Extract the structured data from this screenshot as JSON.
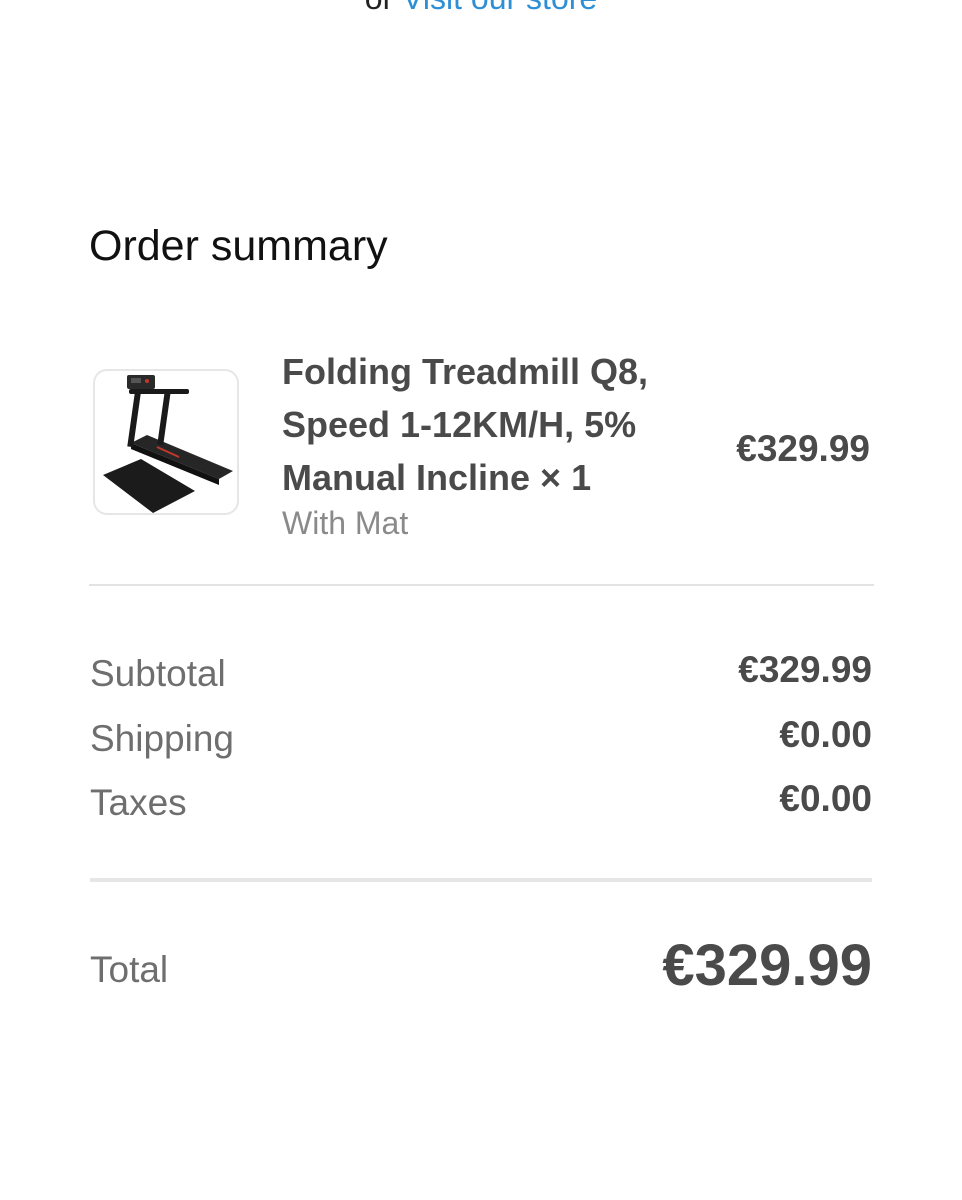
{
  "header": {
    "prefix": "or",
    "store_link": "Visit our store"
  },
  "order_summary": {
    "title": "Order summary",
    "item": {
      "image_icon": "treadmill-product-image",
      "name": "Folding Treadmill Q8, Speed 1-12KM/H, 5% Manual Incline × 1",
      "variant": "With Mat",
      "price": "€329.99"
    },
    "subtotal": {
      "label": "Subtotal",
      "value": "€329.99"
    },
    "shipping": {
      "label": "Shipping",
      "value": "€0.00"
    },
    "taxes": {
      "label": "Taxes",
      "value": "€0.00"
    },
    "total": {
      "label": "Total",
      "value": "€329.99"
    }
  },
  "colors": {
    "link": "#2f8fd4",
    "text_dark": "#4a4a4a",
    "text_muted": "#6e6e6e",
    "divider": "#e3e3e3"
  }
}
